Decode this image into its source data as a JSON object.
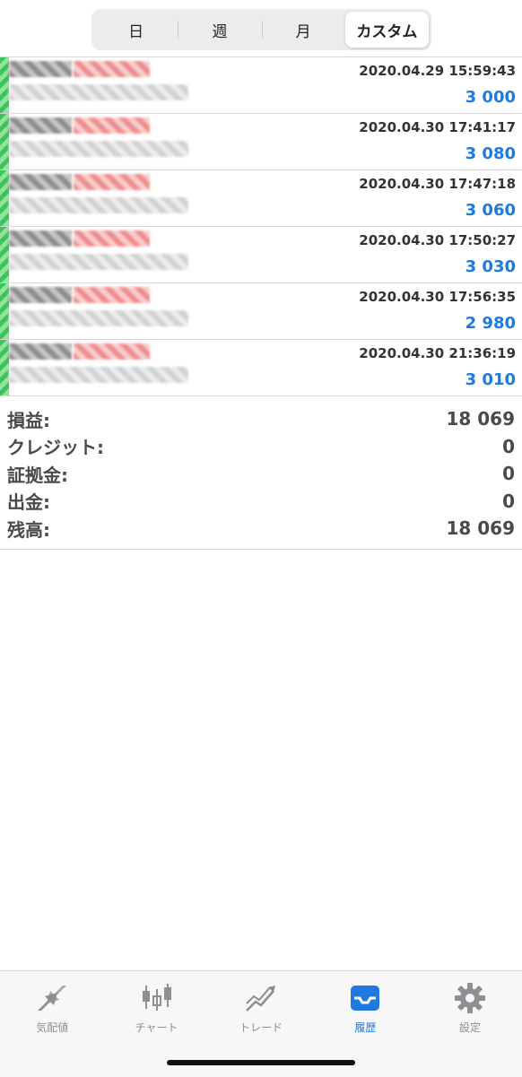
{
  "segments": [
    {
      "label": "日"
    },
    {
      "label": "週"
    },
    {
      "label": "月"
    },
    {
      "label": "カスタム"
    }
  ],
  "deposits": [
    {
      "datetime": "2020.04.29 15:59:43",
      "amount": "3 000"
    },
    {
      "datetime": "2020.04.30 17:41:17",
      "amount": "3 080"
    },
    {
      "datetime": "2020.04.30 17:47:18",
      "amount": "3 060"
    },
    {
      "datetime": "2020.04.30 17:50:27",
      "amount": "3 030"
    },
    {
      "datetime": "2020.04.30 17:56:35",
      "amount": "2 980"
    },
    {
      "datetime": "2020.04.30 21:36:19",
      "amount": "3 010"
    }
  ],
  "summary": {
    "profit": {
      "label": "損益:",
      "value": "18 069"
    },
    "credit": {
      "label": "クレジット:",
      "value": "0"
    },
    "margin": {
      "label": "証拠金:",
      "value": "0"
    },
    "withdrawal": {
      "label": "出金:",
      "value": "0"
    },
    "balance": {
      "label": "残高:",
      "value": "18 069"
    }
  },
  "tabs": [
    {
      "label": "気配値",
      "icon": "quotes-arrows-icon"
    },
    {
      "label": "チャート",
      "icon": "candlestick-chart-icon"
    },
    {
      "label": "トレード",
      "icon": "trade-trend-icon"
    },
    {
      "label": "履歴",
      "icon": "history-inbox-icon"
    },
    {
      "label": "設定",
      "icon": "gear-icon"
    }
  ],
  "colors": {
    "accent": "#1f7ae0",
    "inactive": "#8e8e93",
    "text": "#333333"
  }
}
